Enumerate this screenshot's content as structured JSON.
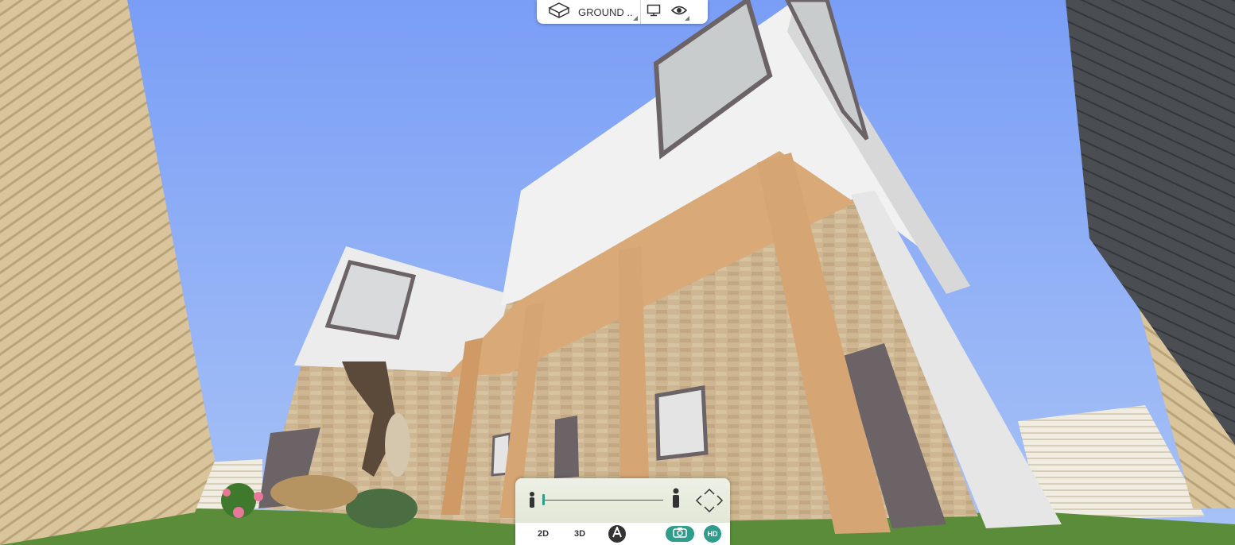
{
  "app": {
    "accent_color": "#2f9c8c"
  },
  "top_toolbar": {
    "level_label": "GROUND ...",
    "level_icon": "cube-wireframe-icon",
    "display_icon": "monitor-icon",
    "visibility_icon": "eye-icon"
  },
  "bottom_panel": {
    "camera_height": 0.0,
    "mode_2d": "2D",
    "mode_3d": "3D",
    "auto_icon": "compass-a-icon",
    "camera_icon": "camera-icon",
    "hd_label": "HD"
  },
  "scene_colors": {
    "sky": "#7ea2f7",
    "grass": "#5b8c3a",
    "brick": "#c9b28e",
    "wood": "#d6a574",
    "wall_white": "#ececec",
    "door": "#6b6366"
  }
}
